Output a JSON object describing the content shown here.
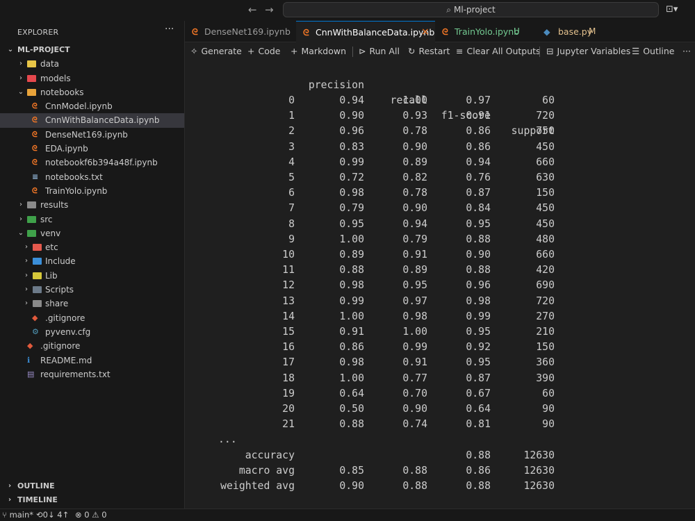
{
  "titlebar": {
    "search_text": "Ml-project",
    "back_icon": "arrow-left-icon",
    "forward_icon": "arrow-right-icon"
  },
  "sidebar": {
    "header": "EXPLORER",
    "project": "ML-PROJECT",
    "items": [
      {
        "label": "data",
        "type": "folder",
        "depth": 1,
        "expanded": false,
        "color": "#e8c547"
      },
      {
        "label": "models",
        "type": "folder",
        "depth": 1,
        "expanded": false,
        "color": "#e5484d"
      },
      {
        "label": "notebooks",
        "type": "folder",
        "depth": 1,
        "expanded": true,
        "color": "#e8a33a"
      },
      {
        "label": "CnnModel.ipynb",
        "type": "notebook",
        "depth": 2
      },
      {
        "label": "CnnWithBalanceData.ipynb",
        "type": "notebook",
        "depth": 2,
        "selected": true
      },
      {
        "label": "DenseNet169.ipynb",
        "type": "notebook",
        "depth": 2
      },
      {
        "label": "EDA.ipynb",
        "type": "notebook",
        "depth": 2
      },
      {
        "label": "notebookf6b394a48f.ipynb",
        "type": "notebook",
        "depth": 2
      },
      {
        "label": "notebooks.txt",
        "type": "text",
        "depth": 2
      },
      {
        "label": "TrainYolo.ipynb",
        "type": "notebook",
        "depth": 2
      },
      {
        "label": "results",
        "type": "folder",
        "depth": 1,
        "expanded": false,
        "color": "#8a8a8a"
      },
      {
        "label": "src",
        "type": "folder",
        "depth": 1,
        "expanded": false,
        "color": "#3fa14a"
      },
      {
        "label": "venv",
        "type": "folder",
        "depth": 1,
        "expanded": true,
        "color": "#3fa14a"
      },
      {
        "label": "etc",
        "type": "folder",
        "depth": 2,
        "expanded": false,
        "color": "#e5594d"
      },
      {
        "label": "Include",
        "type": "folder",
        "depth": 2,
        "expanded": false,
        "color": "#3b8fd9"
      },
      {
        "label": "Lib",
        "type": "folder",
        "depth": 2,
        "expanded": false,
        "color": "#d6c83a"
      },
      {
        "label": "Scripts",
        "type": "folder",
        "depth": 2,
        "expanded": false,
        "color": "#6c7a89"
      },
      {
        "label": "share",
        "type": "folder",
        "depth": 2,
        "expanded": false,
        "color": "#8a8a8a"
      },
      {
        "label": ".gitignore",
        "type": "git",
        "depth": 2
      },
      {
        "label": "pyvenv.cfg",
        "type": "cfg",
        "depth": 2
      },
      {
        "label": ".gitignore",
        "type": "git",
        "depth": 1
      },
      {
        "label": "README.md",
        "type": "info",
        "depth": 1
      },
      {
        "label": "requirements.txt",
        "type": "req",
        "depth": 1
      }
    ],
    "outline": "OUTLINE",
    "timeline": "TIMELINE"
  },
  "tabs": [
    {
      "label": "DenseNet169.ipynb",
      "badge": "",
      "active": false
    },
    {
      "label": "CnnWithBalanceData.ipynb",
      "badge": "×",
      "active": true
    },
    {
      "label": "TrainYolo.ipynb",
      "badge": "U",
      "active": false
    },
    {
      "label": "base.py",
      "badge": "M",
      "active": false
    }
  ],
  "colors": {
    "git_untracked": "#73c991",
    "git_modified": "#e2c08d",
    "notebook": "#f37726",
    "accent": "#0078d4"
  },
  "toolbar": {
    "generate": "Generate",
    "code": "Code",
    "markdown": "Markdown",
    "run_all": "Run All",
    "restart": "Restart",
    "clear_outputs": "Clear All Outputs",
    "jupyter_variables": "Jupyter Variables",
    "outline": "Outline",
    "more": "···"
  },
  "report": {
    "headers": [
      "precision",
      "recall",
      "f1-score",
      "support"
    ],
    "rows": [
      [
        "0",
        "0.94",
        "1.00",
        "0.97",
        "60"
      ],
      [
        "1",
        "0.90",
        "0.93",
        "0.91",
        "720"
      ],
      [
        "2",
        "0.96",
        "0.78",
        "0.86",
        "750"
      ],
      [
        "3",
        "0.83",
        "0.90",
        "0.86",
        "450"
      ],
      [
        "4",
        "0.99",
        "0.89",
        "0.94",
        "660"
      ],
      [
        "5",
        "0.72",
        "0.82",
        "0.76",
        "630"
      ],
      [
        "6",
        "0.98",
        "0.78",
        "0.87",
        "150"
      ],
      [
        "7",
        "0.79",
        "0.90",
        "0.84",
        "450"
      ],
      [
        "8",
        "0.95",
        "0.94",
        "0.95",
        "450"
      ],
      [
        "9",
        "1.00",
        "0.79",
        "0.88",
        "480"
      ],
      [
        "10",
        "0.89",
        "0.91",
        "0.90",
        "660"
      ],
      [
        "11",
        "0.88",
        "0.89",
        "0.88",
        "420"
      ],
      [
        "12",
        "0.98",
        "0.95",
        "0.96",
        "690"
      ],
      [
        "13",
        "0.99",
        "0.97",
        "0.98",
        "720"
      ],
      [
        "14",
        "1.00",
        "0.98",
        "0.99",
        "270"
      ],
      [
        "15",
        "0.91",
        "1.00",
        "0.95",
        "210"
      ],
      [
        "16",
        "0.86",
        "0.99",
        "0.92",
        "150"
      ],
      [
        "17",
        "0.98",
        "0.91",
        "0.95",
        "360"
      ],
      [
        "18",
        "1.00",
        "0.77",
        "0.87",
        "390"
      ],
      [
        "19",
        "0.64",
        "0.70",
        "0.67",
        "60"
      ],
      [
        "20",
        "0.50",
        "0.90",
        "0.64",
        "90"
      ],
      [
        "21",
        "0.88",
        "0.74",
        "0.81",
        "90"
      ]
    ],
    "ellipsis": "...",
    "summary": [
      [
        "accuracy",
        "",
        "",
        "0.88",
        "12630"
      ],
      [
        "macro avg",
        "0.85",
        "0.88",
        "0.86",
        "12630"
      ],
      [
        "weighted avg",
        "0.90",
        "0.88",
        "0.88",
        "12630"
      ]
    ]
  },
  "statusbar": {
    "branch": "main*",
    "sync": "0↓ 4↑",
    "errors": "0",
    "warnings": "0"
  }
}
